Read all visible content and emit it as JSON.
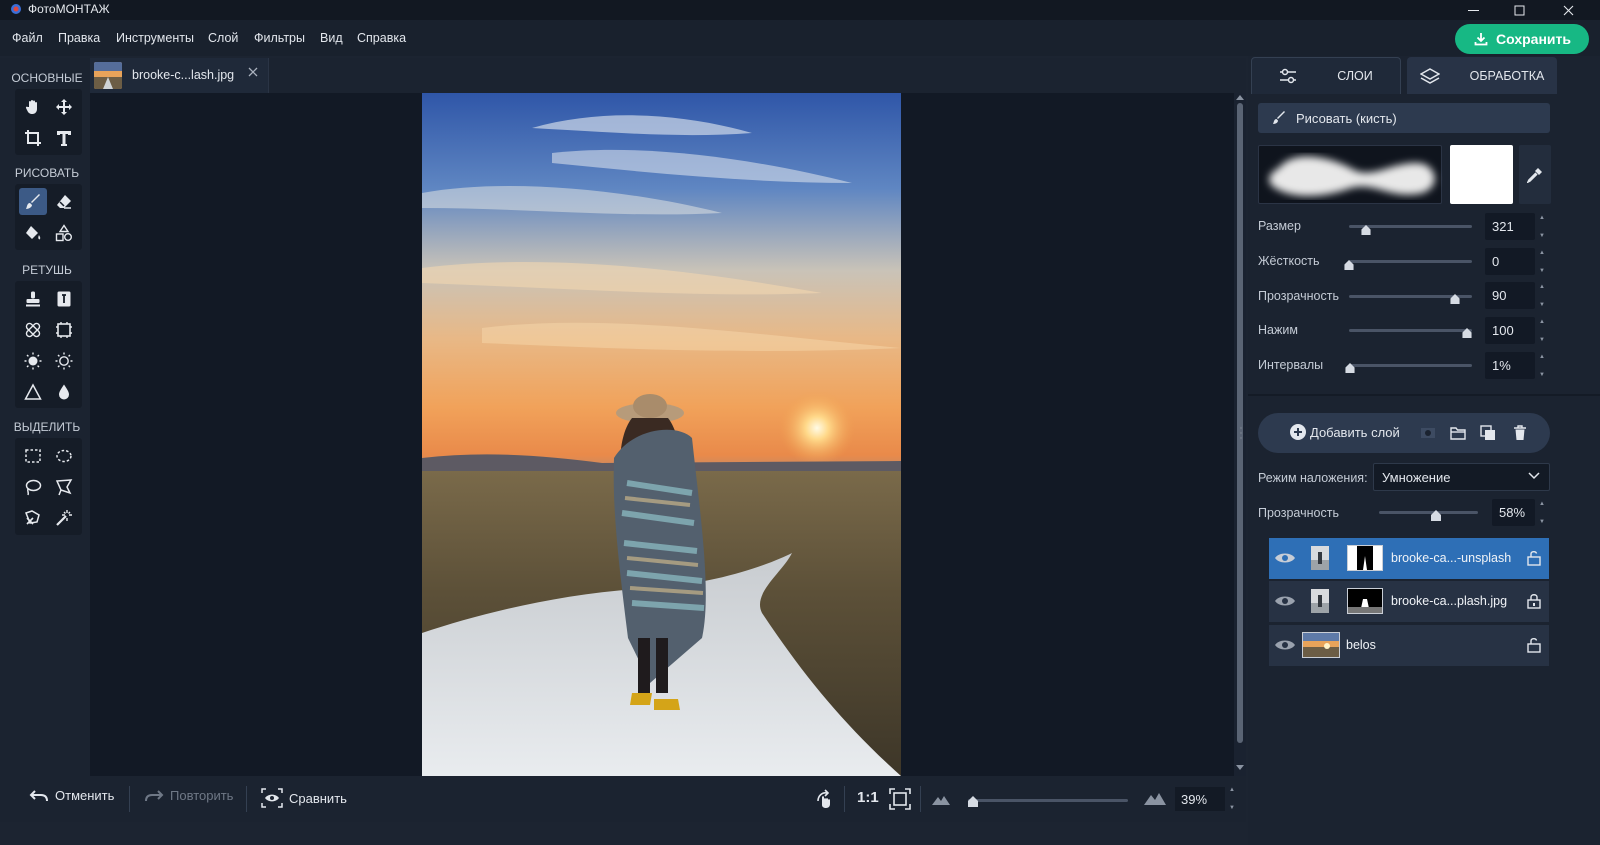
{
  "app": {
    "title": "ФотоМОНТАЖ",
    "save_label": "Сохранить",
    "accent_color": "#17b884",
    "selection_color": "#2e6fb6"
  },
  "menu": [
    "Файл",
    "Правка",
    "Инструменты",
    "Слой",
    "Фильтры",
    "Вид",
    "Справка"
  ],
  "tools": {
    "sections": [
      "ОСНОВНЫЕ",
      "РИСОВАТЬ",
      "РЕТУШЬ",
      "ВЫДЕЛИТЬ"
    ],
    "active_tool": "brush-tool"
  },
  "document": {
    "tab_title": "brooke-c...lash.jpg"
  },
  "bottom": {
    "undo_label": "Отменить",
    "redo_label": "Повторить",
    "compare_label": "Сравнить",
    "ratio_label": "1:1",
    "zoom_value": "39%",
    "zoom_level": 0.03
  },
  "right_panel": {
    "tab_layers": "СЛОИ",
    "tab_processing": "ОБРАБОТКА",
    "mode_button": "Рисовать (кисть)",
    "brush_color": "#ffffff",
    "params": [
      {
        "label": "Размер",
        "value": "321",
        "level": 0.14
      },
      {
        "label": "Жёсткость",
        "value": "0",
        "level": 0.0
      },
      {
        "label": "Прозрачность",
        "value": "90",
        "level": 0.9
      },
      {
        "label": "Нажим",
        "value": "100",
        "level": 1.0
      },
      {
        "label": "Интервалы",
        "value": "1%",
        "level": 0.01
      }
    ],
    "add_layer_label": "Добавить слой",
    "blend_label": "Режим наложения:",
    "blend_value": "Умножение",
    "layer_opacity_label": "Прозрачность",
    "layer_opacity_value": "58%",
    "layer_opacity_level": 0.58,
    "layers": [
      {
        "name": "brooke-ca...-unsplash",
        "selected": true,
        "locked": false
      },
      {
        "name": "brooke-ca...plash.jpg",
        "selected": false,
        "locked": true
      },
      {
        "name": "belos",
        "selected": false,
        "locked": false
      }
    ]
  }
}
